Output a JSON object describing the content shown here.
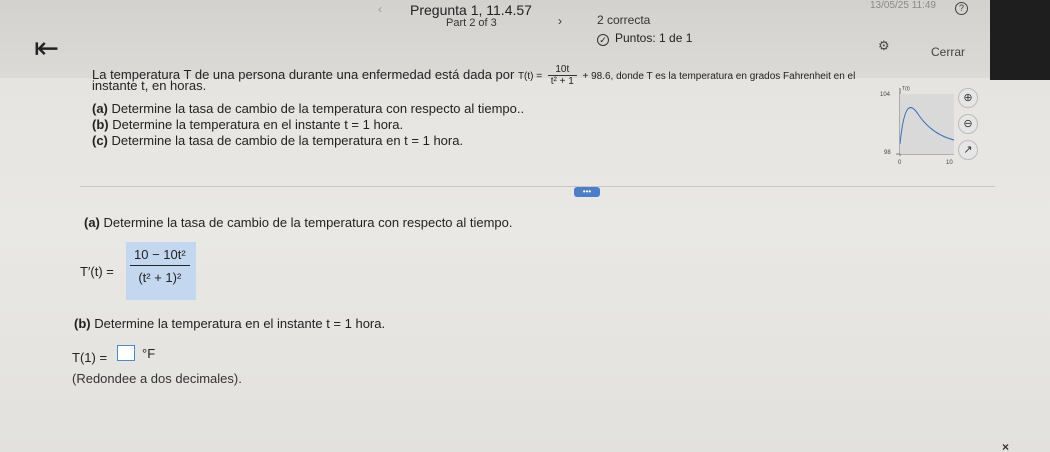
{
  "header": {
    "question_title": "Pregunta 1, 11.4.57",
    "part": "Part 2 of 3",
    "correct": "2 correcta",
    "points": "Puntos: 1 de 1",
    "timestamp": "13/05/25 11:49",
    "close_label": "Cerrar",
    "prev_icon": "‹",
    "next_icon": "›",
    "back_icon": "⇤",
    "help_icon": "?"
  },
  "problem": {
    "intro": "La temperatura T de una persona durante una enfermedad está dada por",
    "func_lhs": "T(t) =",
    "frac_num": "10t",
    "frac_den": "t² + 1",
    "tail": "+ 98.6, donde T es la temperatura en grados Fahrenheit en el",
    "line2": "instante t, en horas.",
    "items": [
      {
        "label": "(a)",
        "text": "Determine la tasa de cambio de la temperatura con respecto al tiempo.."
      },
      {
        "label": "(b)",
        "text": "Determine la temperatura en el instante t = 1 hora."
      },
      {
        "label": "(c)",
        "text": "Determine la tasa de cambio de la temperatura en t = 1 hora."
      }
    ]
  },
  "graph": {
    "y_top": "104",
    "y_bottom": "98",
    "x_left": "0",
    "x_right": "10",
    "y_axis_name": "T(t)"
  },
  "tools": [
    "zoom-in-icon",
    "zoom-out-icon",
    "external-link-icon"
  ],
  "more_label": "•••",
  "section_a": {
    "label": "(a)",
    "text": "Determine la tasa de cambio de la temperatura con respecto al tiempo.",
    "lhs": "T′(t) =",
    "answer_num": "10 − 10t²",
    "answer_den": "(t² + 1)²"
  },
  "section_b": {
    "label": "(b)",
    "text": "Determine la temperatura en el instante t = 1 hora.",
    "lhs": "T(1) =",
    "input_value": "",
    "unit": "°F",
    "note": "(Redondee a dos decimales)."
  },
  "close_x": "×"
}
